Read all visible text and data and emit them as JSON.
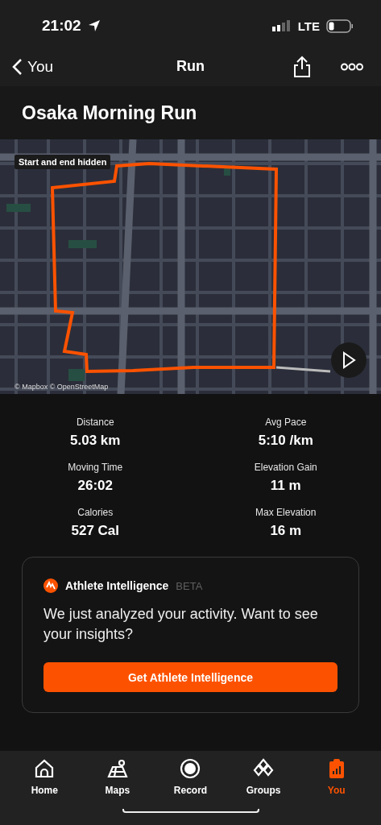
{
  "status_bar": {
    "time": "21:02",
    "network": "LTE"
  },
  "nav": {
    "back_label": "You",
    "title": "Run"
  },
  "activity": {
    "title": "Osaka Morning Run"
  },
  "map": {
    "kind": "picture",
    "badge": "Start and end hidden",
    "attribution": "© Mapbox © OpenStreetMap"
  },
  "stats": [
    {
      "label": "Distance",
      "value": "5.03 km"
    },
    {
      "label": "Avg Pace",
      "value": "5:10 /km"
    },
    {
      "label": "Moving Time",
      "value": "26:02"
    },
    {
      "label": "Elevation Gain",
      "value": "11 m"
    },
    {
      "label": "Calories",
      "value": "527 Cal"
    },
    {
      "label": "Max Elevation",
      "value": "16 m"
    }
  ],
  "promo": {
    "title": "Athlete Intelligence",
    "tag": "BETA",
    "text": "We just analyzed your activity. Want to see your insights?",
    "button": "Get Athlete Intelligence"
  },
  "tabs": [
    {
      "kind": "home",
      "label": "Home",
      "selected": false
    },
    {
      "kind": "maps",
      "label": "Maps",
      "selected": false
    },
    {
      "kind": "record",
      "label": "Record",
      "selected": false
    },
    {
      "kind": "groups",
      "label": "Groups",
      "selected": false
    },
    {
      "kind": "you",
      "label": "You",
      "selected": true
    }
  ]
}
